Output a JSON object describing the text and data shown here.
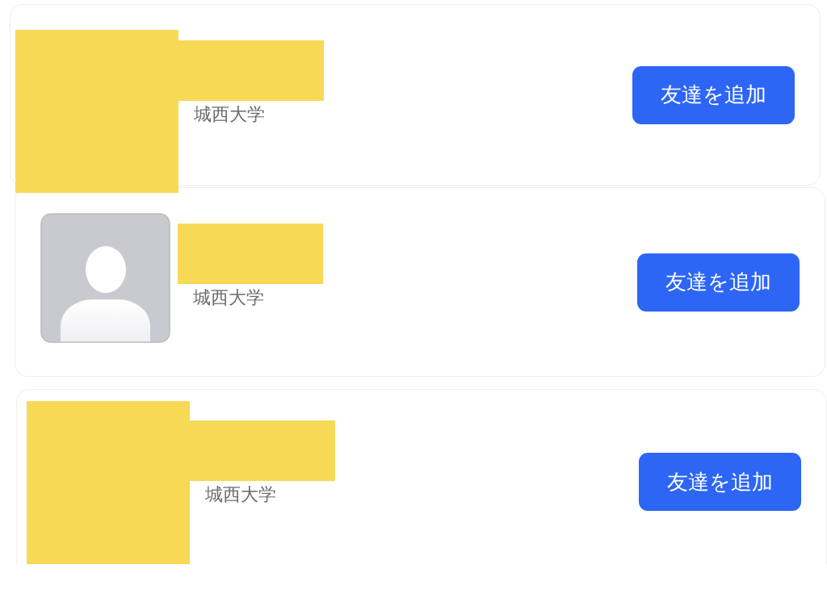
{
  "friend_suggestions": [
    {
      "avatar": {
        "kind": "redacted"
      },
      "name": {
        "kind": "redacted"
      },
      "university": "城西大学",
      "button": "友達を追加"
    },
    {
      "avatar": {
        "kind": "silhouette"
      },
      "name": {
        "kind": "redacted"
      },
      "university": "城西大学",
      "button": "友達を追加"
    },
    {
      "avatar": {
        "kind": "redacted"
      },
      "name": {
        "kind": "redacted"
      },
      "university": "城西大学",
      "button": "友達を追加"
    }
  ]
}
